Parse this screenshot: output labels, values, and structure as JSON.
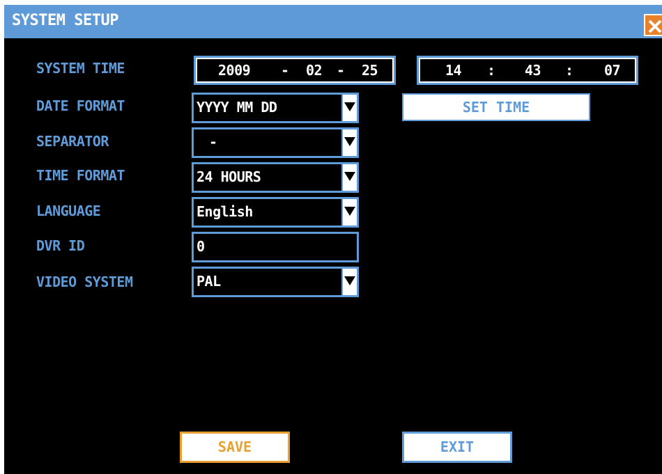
{
  "window": {
    "title": "SYSTEM SETUP"
  },
  "labels": {
    "system_time": "SYSTEM TIME",
    "date_format": "DATE FORMAT",
    "separator": "SEPARATOR",
    "time_format": "TIME FORMAT",
    "language": "LANGUAGE",
    "dvr_id": "DVR ID",
    "video_system": "VIDEO SYSTEM"
  },
  "date": {
    "year": "2009",
    "sep1": "-",
    "month": "02",
    "sep2": "-",
    "day": "25"
  },
  "time": {
    "hour": "14",
    "sep1": ":",
    "minute": "43",
    "sep2": ":",
    "second": "07"
  },
  "values": {
    "date_format": "YYYY MM DD",
    "separator": "-",
    "time_format": "24 HOURS",
    "language": "English",
    "dvr_id": "0",
    "video_system": "PAL"
  },
  "buttons": {
    "set_time": "SET TIME",
    "save": "SAVE",
    "exit": "EXIT"
  },
  "colors": {
    "titlebar": "#5e9ad7",
    "label": "#5f9bd8",
    "save_accent": "#e8a030",
    "close": "#e8822a"
  },
  "icons": {
    "close": "close-icon",
    "dropdown": "triangle-down-icon"
  }
}
